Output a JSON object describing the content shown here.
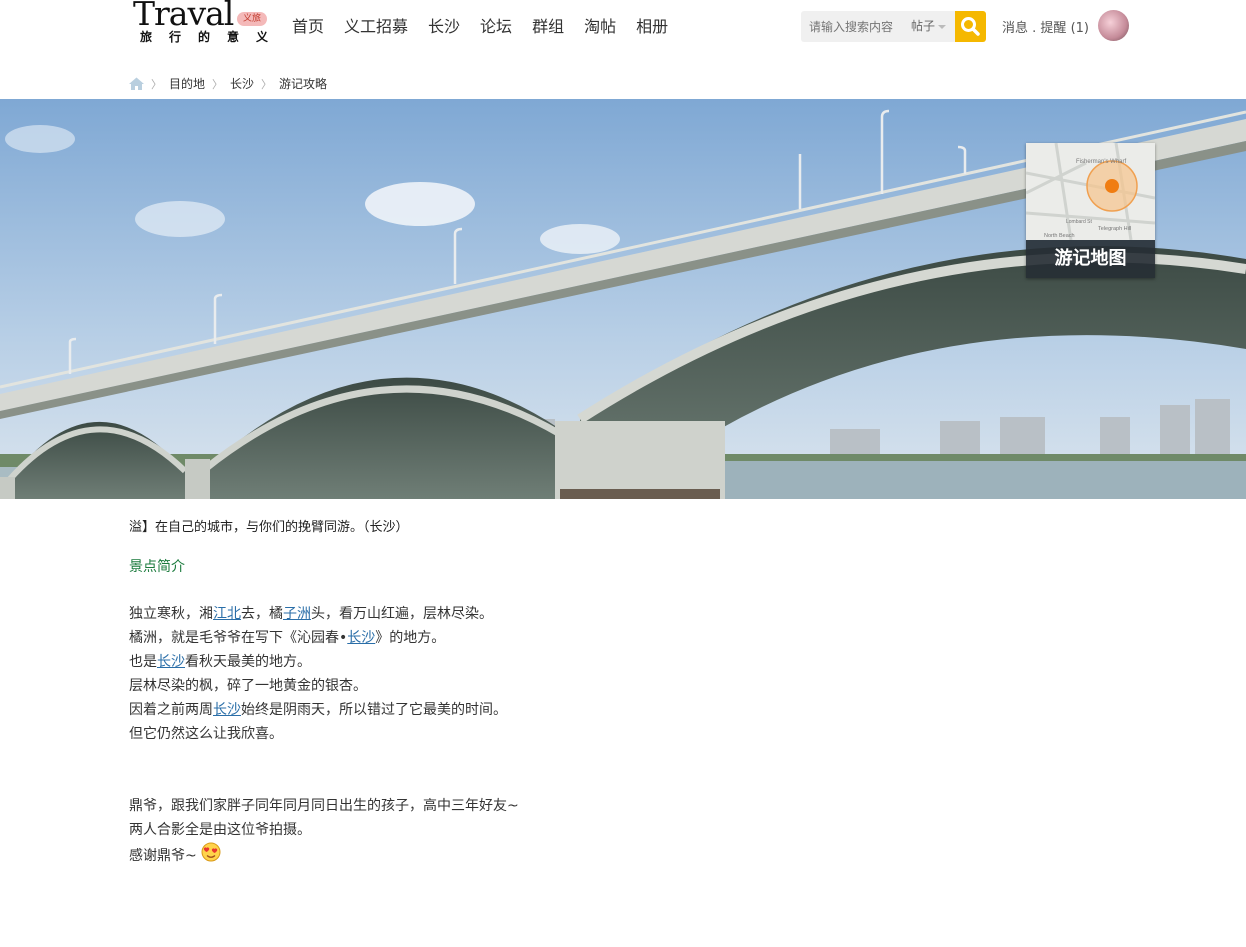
{
  "logo": {
    "main": "Traval",
    "badge": "义旅",
    "sub": "旅行的意义"
  },
  "nav": [
    "首页",
    "义工招募",
    "长沙",
    "论坛",
    "群组",
    "淘帖",
    "相册"
  ],
  "search": {
    "placeholder": "请输入搜索内容",
    "type": "帖子",
    "accent": "#f5b800"
  },
  "user": {
    "messages": "消息",
    "remind": "提醒",
    "remind_count": "(1)"
  },
  "breadcrumb": [
    "目的地",
    "长沙",
    "游记攻略"
  ],
  "map_card": {
    "label": "游记地图",
    "map_texts": [
      "Fisherman's Wharf",
      "Lombard St",
      "North Beach",
      "Telegraph Hill"
    ]
  },
  "article": {
    "title": "溢】在自己的城市，与你们的挽臂同游。（长沙）",
    "section": "景点简介",
    "p1": {
      "l1": {
        "a": "独立寒秋，湘",
        "b": "江北",
        "c": "去，橘",
        "d": "子洲",
        "e": "头，看万山红遍，层林尽染。"
      },
      "l2": {
        "a": "橘洲，就是毛爷爷在写下《沁园春•",
        "b": "长沙",
        "c": "》的地方。"
      },
      "l3": {
        "a": "也是",
        "b": "长沙",
        "c": "看秋天最美的地方。"
      },
      "l4": "层林尽染的枫，碎了一地黄金的银杏。",
      "l5": {
        "a": "因着之前两周",
        "b": "长沙",
        "c": "始终是阴雨天，所以错过了它最美的时间。"
      },
      "l6": "但它仍然这么让我欣喜。"
    },
    "p2": {
      "l1": "鼎爷，跟我们家胖子同年同月同日出生的孩子，高中三年好友~",
      "l2": "两人合影全是由这位爷拍摄。",
      "l3": "感谢鼎爷~"
    }
  }
}
